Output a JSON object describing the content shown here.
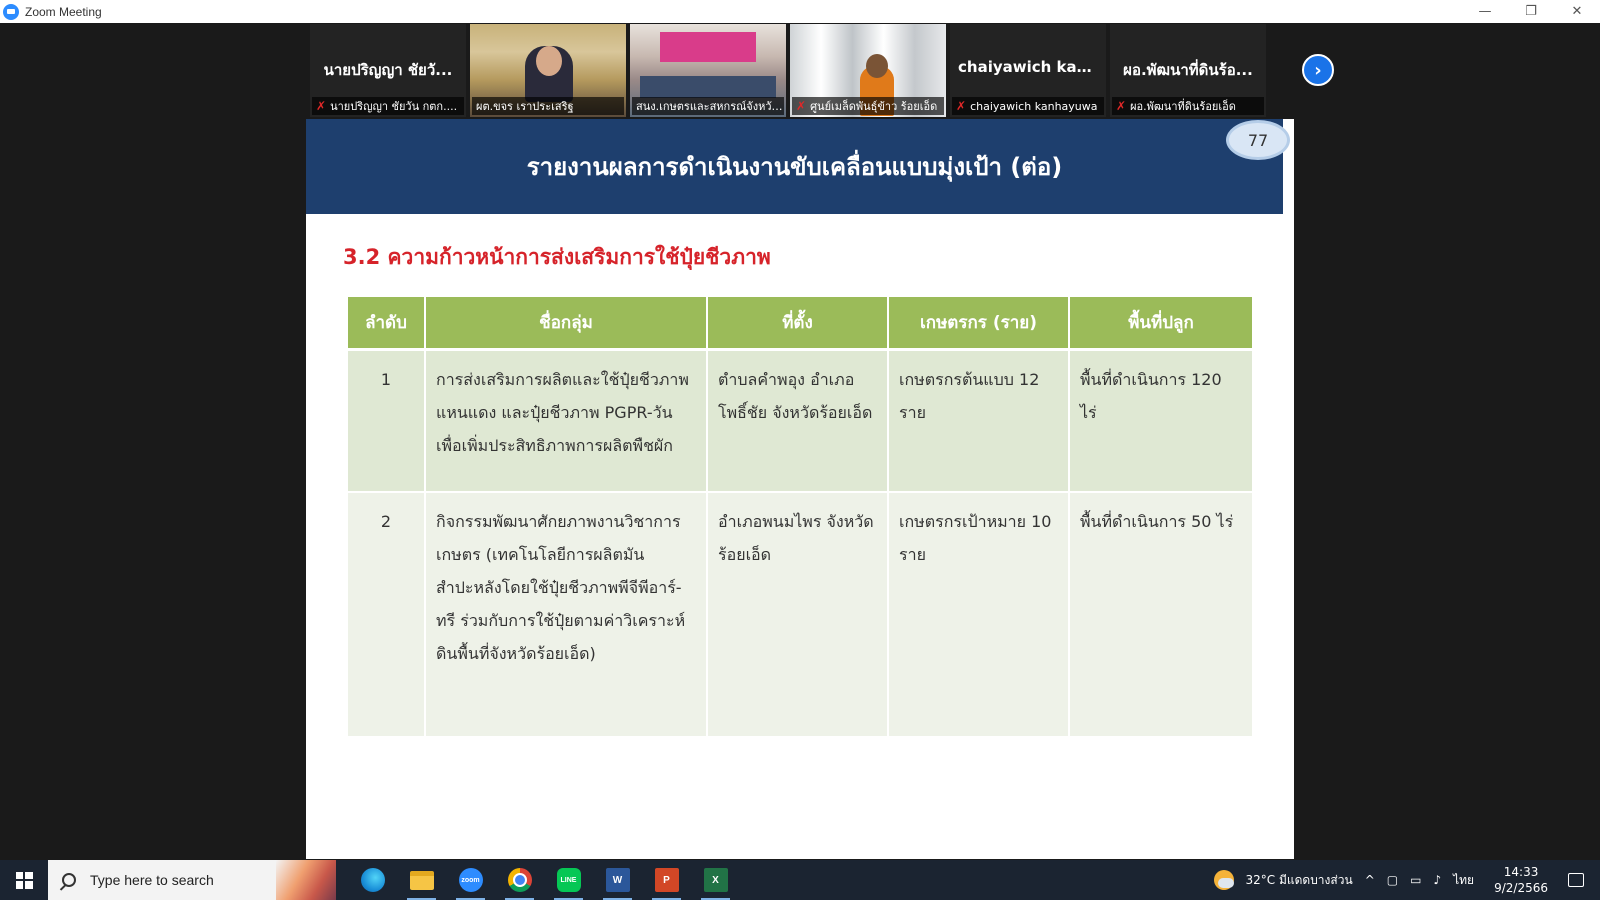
{
  "window": {
    "title": "Zoom Meeting",
    "minimize": "—",
    "restore": "❐",
    "close": "✕"
  },
  "gallery": {
    "tiles": [
      {
        "big_name": "นายปริญญา ชัยวั...",
        "caption": "นายปริญญา ชัยวัน กตก....",
        "muted": true,
        "video": false
      },
      {
        "big_name": "",
        "caption": "ผต.ขจร เราประเสริฐ",
        "muted": false,
        "video": true
      },
      {
        "big_name": "",
        "caption": "สนง.เกษตรและสหกรณ์จังหวัด...",
        "muted": false,
        "video": true
      },
      {
        "big_name": "",
        "caption": "ศูนย์เมล็ดพันธุ์ข้าว ร้อยเอ็ด",
        "muted": true,
        "video": true
      },
      {
        "big_name": "chaiyawich kanh...",
        "caption": "chaiyawich kanhayuwa",
        "muted": true,
        "video": false
      },
      {
        "big_name": "ผอ.พัฒนาที่ดินร้อ...",
        "caption": "ผอ.พัฒนาที่ดินร้อยเอ็ด",
        "muted": true,
        "video": false
      }
    ],
    "mute_symbol": "✗",
    "next_symbol": "›"
  },
  "slide": {
    "title": "รายงานผลการดำเนินงานขับเคลื่อนแบบมุ่งเป้า (ต่อ)",
    "page_number": "77",
    "section_title": "3.2 ความก้าวหน้าการส่งเสริมการใช้ปุ๋ยชีวภาพ",
    "table": {
      "headers": [
        "ลำดับ",
        "ชื่อกลุ่ม",
        "ที่ตั้ง",
        "เกษตรกร (ราย)",
        "พื้นที่ปลูก"
      ],
      "rows": [
        {
          "no": "1",
          "group": "การส่งเสริมการผลิตและใช้ปุ๋ยชีวภาพแหนแดง และปุ๋ยชีวภาพ PGPR-วัน เพื่อเพิ่มประสิทธิภาพการผลิตพืชผัก",
          "location": "ตำบลคำพอุง อำเภอโพธิ์ชัย จังหวัดร้อยเอ็ด",
          "farmers": "เกษตรกรต้นแบบ 12 ราย",
          "area": "พื้นที่ดำเนินการ 120 ไร่"
        },
        {
          "no": "2",
          "group": "กิจกรรมพัฒนาศักยภาพงานวิชาการเกษตร (เทคโนโลยีการผลิตมันสำปะหลังโดยใช้ปุ๋ยชีวภาพพีจีพีอาร์-ทรี ร่วมกับการใช้ปุ๋ยตามค่าวิเคราะห์ดินพื้นที่จังหวัดร้อยเอ็ด)",
          "location": "อำเภอพนมไพร จังหวัดร้อยเอ็ด",
          "farmers": "เกษตรกรเป้าหมาย 10 ราย",
          "area": "พื้นที่ดำเนินการ 50 ไร่"
        }
      ]
    }
  },
  "taskbar": {
    "search_placeholder": "Type here to search",
    "apps": [
      "edge-icon",
      "file-explorer-icon",
      "zoom-icon",
      "chrome-icon",
      "line-icon",
      "word-icon",
      "powerpoint-icon",
      "excel-icon"
    ],
    "app_labels": {
      "zoom": "zoom",
      "line": "LINE",
      "word": "W",
      "ppt": "P",
      "excel": "X"
    },
    "weather": "32°C มีแดดบางส่วน",
    "tray_caret": "^",
    "language": "ไทย",
    "time": "14:33",
    "date": "9/2/2566"
  }
}
